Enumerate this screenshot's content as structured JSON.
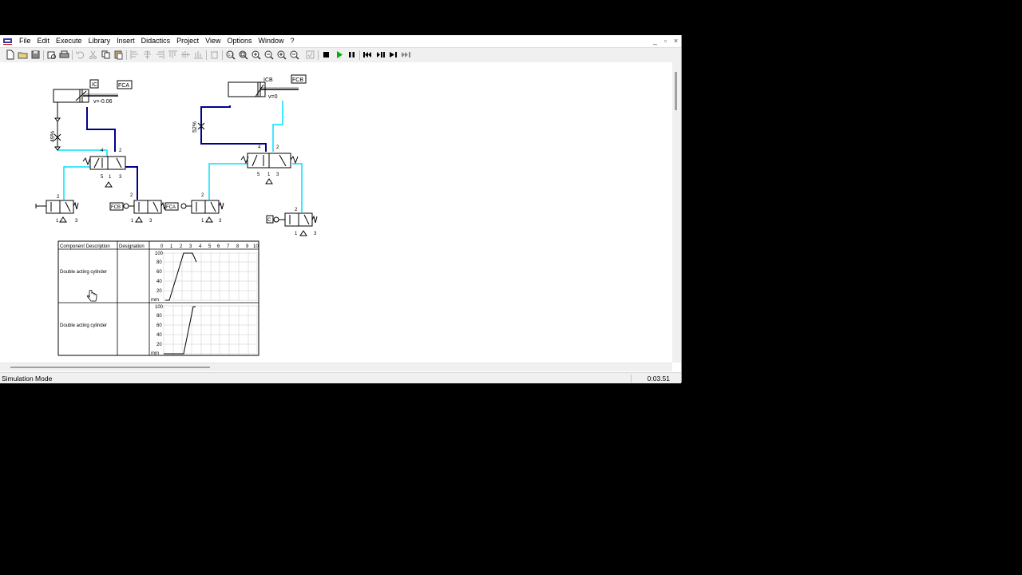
{
  "menu": {
    "items": [
      "File",
      "Edit",
      "Execute",
      "Library",
      "Insert",
      "Didactics",
      "Project",
      "View",
      "Options",
      "Window",
      "?"
    ]
  },
  "window_controls": {
    "minimize": "_",
    "restore": "▫",
    "close": "×"
  },
  "icons": [
    "new-icon",
    "open-icon",
    "save-icon",
    "print-preview-icon",
    "print-icon",
    "undo-icon",
    "cut-icon",
    "copy-icon",
    "paste-icon",
    "align-left-icon",
    "align-center-icon",
    "align-right-icon",
    "align-top-icon",
    "align-middle-icon",
    "align-bottom-icon",
    "delete-icon",
    "zoom-fit-icon",
    "zoom-window-icon",
    "zoom-all-icon",
    "zoom-area-icon",
    "zoom-in-icon",
    "zoom-out-icon",
    "check-icon",
    "stop-icon",
    "play-icon",
    "pause-icon",
    "reset-icon",
    "step-icon",
    "step-forward-icon",
    "skip-end-icon"
  ],
  "colors": {
    "line_pressure": "#00008b",
    "line_exhaust": "#00e0ff",
    "play_green": "#00b000"
  },
  "circuit": {
    "cyl1_label": "IC",
    "cyl1_sensor": "FCA",
    "cyl1_velocity": "v=-0.06",
    "cyl1_throttle": "49%",
    "cyl2_label": "ICB",
    "cyl2_sensor": "FCB",
    "cyl2_velocity": "v=0",
    "cyl2_throttle": "52%",
    "valve1_ports": {
      "p4": "4",
      "p2": "2",
      "p5": "5",
      "p1": "1",
      "p3": "3"
    },
    "valve2_ports": {
      "p4": "4",
      "p2": "2",
      "p5": "5",
      "p1": "1",
      "p3": "3"
    },
    "valve3_ports": {
      "p2": "2",
      "p1": "1",
      "p3": "3"
    },
    "valve4_ports": {
      "p2": "2",
      "p1": "1",
      "p3": "3",
      "tag": "FCB"
    },
    "valve5_ports": {
      "p2": "2",
      "p1": "1",
      "p3": "3",
      "tag": "FCA"
    },
    "valve6_ports": {
      "p2": "2",
      "p1": "1",
      "p3": "3",
      "tag": "C"
    }
  },
  "diagram_table": {
    "col_description": "Component Description",
    "col_designation": "Designation",
    "time_ticks": [
      "0",
      "1",
      "2",
      "3",
      "4",
      "5",
      "6",
      "7",
      "8",
      "9",
      "10"
    ],
    "rows": [
      {
        "description": "Double acting cylinder",
        "y_ticks": [
          "100",
          "80",
          "60",
          "40",
          "20",
          "mm"
        ]
      },
      {
        "description": "Double acting cylinder",
        "y_ticks": [
          "100",
          "80",
          "60",
          "40",
          "20",
          "mm"
        ]
      }
    ]
  },
  "status": {
    "mode": "Simulation Mode",
    "time": "0:03.51"
  }
}
